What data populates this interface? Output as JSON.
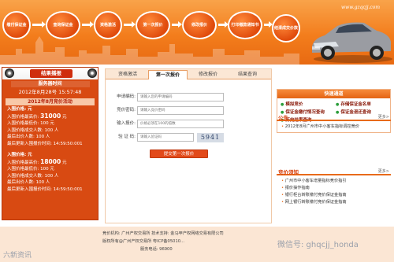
{
  "header": {
    "url": "www.gzqcjj.com",
    "steps": [
      "缴付保证金",
      "查询保证金",
      "资格激活",
      "第一次报价",
      "修改报价",
      "打印缴款通知书",
      "结清成交价款"
    ]
  },
  "left_panel": {
    "title": "结果播报",
    "server_time_label": "服务器时间",
    "server_time": "2012年8月28号 15:57:48",
    "activity": "2012年8月竞价活动",
    "sections": [
      {
        "title": "入围价格: 元",
        "max_label": "入围价格最高价:",
        "max_value": "31000",
        "max_unit": "元",
        "lines": [
          "入围价格最低价: 100 元",
          "入围价格成交人数: 100 人",
          "最后出价人数: 100 人",
          "最后更新入围报价时间: 14:59:50:001"
        ]
      },
      {
        "title": "入围价格: 元",
        "max_label": "入围价格最高价:",
        "max_value": "18000",
        "max_unit": "元",
        "lines": [
          "入围价格最低价: 100 元",
          "入围价格成交人数: 100 人",
          "最后出价人数: 100 人",
          "最后更新入围报价时间: 14:59:50:001"
        ]
      }
    ]
  },
  "center": {
    "tabs": [
      "资格激活",
      "第一次报价",
      "修改报价",
      "结果查询"
    ],
    "active_tab": 1,
    "form": {
      "code_label": "申请编码:",
      "code_placeholder": "请输入您的申请编码",
      "pwd_label": "竞价密码:",
      "pwd_placeholder": "请输入竞价密码",
      "price_label": "输入报价:",
      "price_placeholder": "价格必须在100的倍数",
      "captcha_label": "验 证 码:",
      "captcha_placeholder": "请输入验证码",
      "captcha_text": "5941",
      "submit": "提交第一次报价"
    }
  },
  "right_panel": {
    "quick_title": "快速通道",
    "quick_links": [
      "模拟竞价",
      "存储保证金名单",
      "保证金缴付情况查询",
      "保证金退还查询",
      "历史结果查询"
    ],
    "notice_title": "公告",
    "notice_more": "更多>",
    "notices": [
      "2012年8月广州市中小客车指标调控竞价"
    ],
    "guide_title": "竞价须知",
    "guide_more": "更多>",
    "guides": [
      "广州市中小客车增量指标竞价指引",
      "报价操作指南",
      "银行柜台转账缴付竞价保证金指南",
      "网上银行转账缴付竞价保证金指南"
    ]
  },
  "footer": {
    "line1": "竞价机构: 广州产权交易所 技术支持: 金马甲产权网络交易有限公司",
    "line2": "版权所有@广州产权交易所 粤ICP备05010...",
    "line3": "服务电话: 96900",
    "watermark_left": "六新资讯",
    "watermark_right": "微信号: ghqcjj_honda"
  }
}
